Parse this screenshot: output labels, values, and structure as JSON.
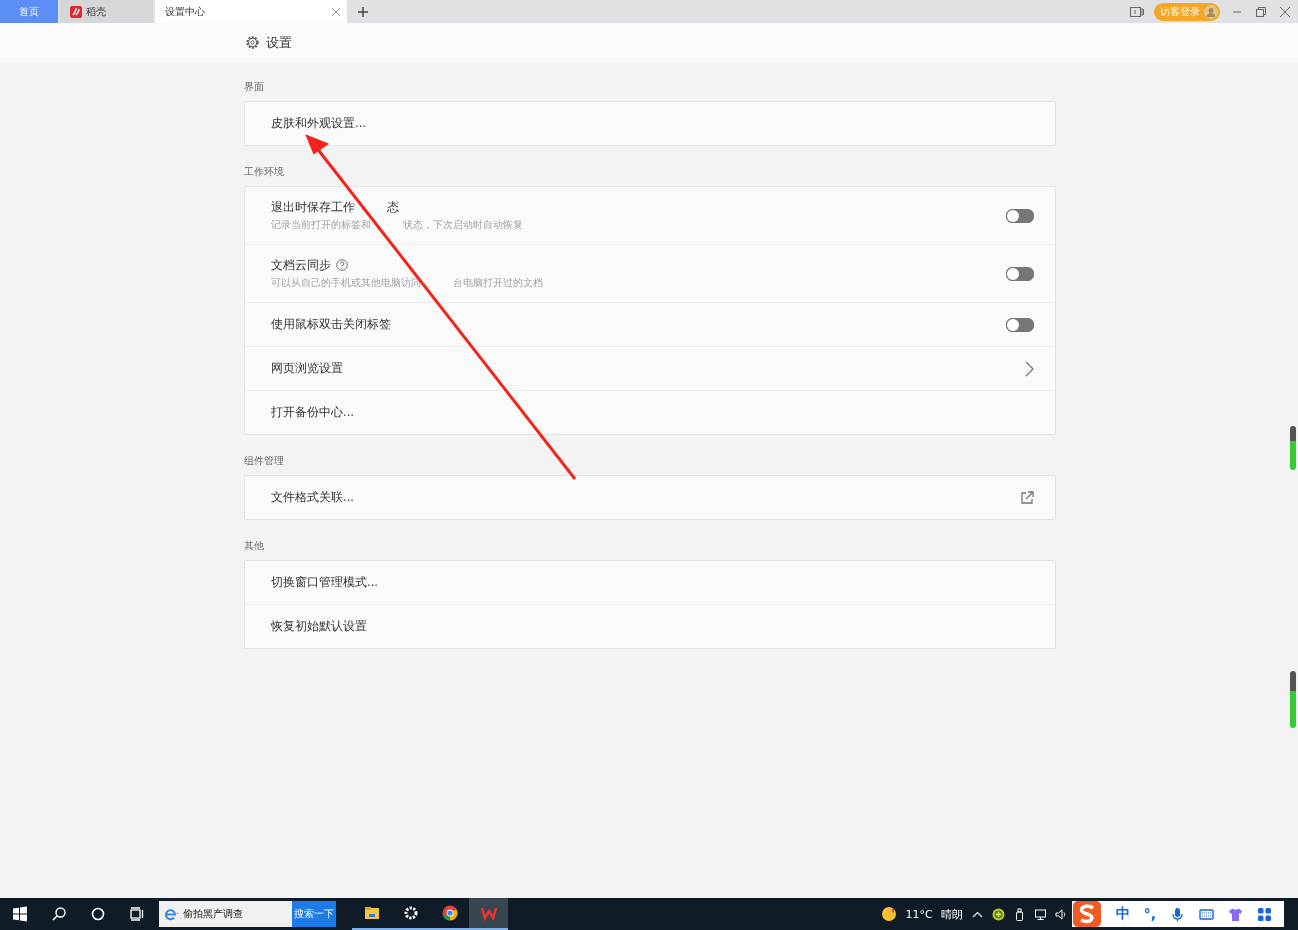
{
  "tabs": [
    {
      "label": "首页",
      "kind": "home",
      "selected": false
    },
    {
      "label": "稻壳",
      "kind": "app",
      "selected": false
    },
    {
      "label": "设置中心",
      "kind": "page",
      "selected": true
    }
  ],
  "account": {
    "label": "访客登录"
  },
  "page_title": "设置",
  "sections": [
    {
      "title": "界面",
      "rows": [
        {
          "title": [
            "皮肤和外观设置..."
          ],
          "kind": "plain"
        }
      ]
    },
    {
      "title": "工作环境",
      "rows": [
        {
          "title": [
            "退出时保存工作",
            "态"
          ],
          "subtitle": [
            "记录当前打开的标签和",
            "状态，下次启动时自动恢复"
          ],
          "kind": "toggle",
          "on": false
        },
        {
          "title": [
            "文档云同步"
          ],
          "subtitle": [
            "可以从自己的手机或其他电脑访问",
            "台电脑打开过的文档"
          ],
          "kind": "toggle",
          "help": true,
          "on": false
        },
        {
          "title": [
            "使用鼠标双击关闭标签"
          ],
          "kind": "toggle",
          "on": false
        },
        {
          "title": [
            "网页浏览设置"
          ],
          "kind": "chevron"
        },
        {
          "title": [
            "打开备份中心..."
          ],
          "kind": "plain"
        }
      ]
    },
    {
      "title": "组件管理",
      "rows": [
        {
          "title": [
            "文件格式关联..."
          ],
          "kind": "external"
        }
      ]
    },
    {
      "title": "其他",
      "rows": [
        {
          "title": [
            "切换窗口管理模式..."
          ],
          "kind": "plain"
        },
        {
          "title": [
            "恢复初始默认设置"
          ],
          "kind": "plain"
        }
      ]
    }
  ],
  "taskbar": {
    "search": {
      "value": "偷拍黑产调查",
      "button": "搜索一下"
    },
    "apps": [
      {
        "kind": "explorer",
        "running": true,
        "active": false
      },
      {
        "kind": "settings",
        "running": true,
        "active": false
      },
      {
        "kind": "chrome",
        "running": true,
        "active": false
      },
      {
        "kind": "wps",
        "running": true,
        "active": true
      }
    ],
    "weather": {
      "temperature": "11°C",
      "condition": "晴朗"
    },
    "ime": {
      "mode": "中",
      "punctuation": "°,"
    }
  }
}
